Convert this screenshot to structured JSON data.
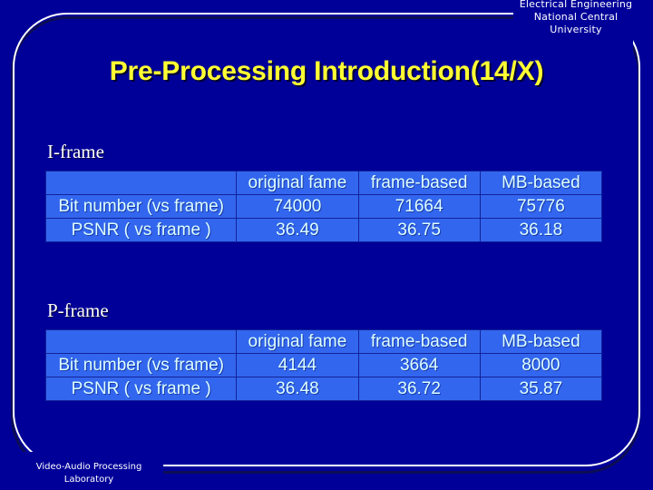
{
  "slide": {
    "background_color": "#000099",
    "title": "Pre-Processing Introduction(14/X)",
    "title_color": "#ffff33",
    "header_line1": "Electrical Engineering",
    "header_line2": "National Central",
    "header_line3": "University",
    "footer_line1": "Video-Audio Processing",
    "footer_line2": "Laboratory"
  },
  "sections": {
    "iframe": {
      "label": "I-frame",
      "table": {
        "corner": "",
        "columns": [
          "original fame",
          "frame-based",
          "MB-based"
        ],
        "rows": [
          {
            "label": "Bit number (vs frame)",
            "values": [
              "74000",
              "71664",
              "75776"
            ]
          },
          {
            "label": "PSNR ( vs frame )",
            "values": [
              "36.49",
              "36.75",
              "36.18"
            ]
          }
        ]
      }
    },
    "pframe": {
      "label": "P-frame",
      "table": {
        "corner": "",
        "columns": [
          "original fame",
          "frame-based",
          "MB-based"
        ],
        "rows": [
          {
            "label": "Bit number (vs frame)",
            "values": [
              "4144",
              "3664",
              "8000"
            ]
          },
          {
            "label": "PSNR ( vs frame )",
            "values": [
              "36.48",
              "36.72",
              "35.87"
            ]
          }
        ]
      }
    }
  },
  "colors": {
    "cell_background": "#3366ee",
    "cell_text": "#ddffff",
    "cell_border": "#12229a",
    "frame_border": "#ffffff"
  }
}
